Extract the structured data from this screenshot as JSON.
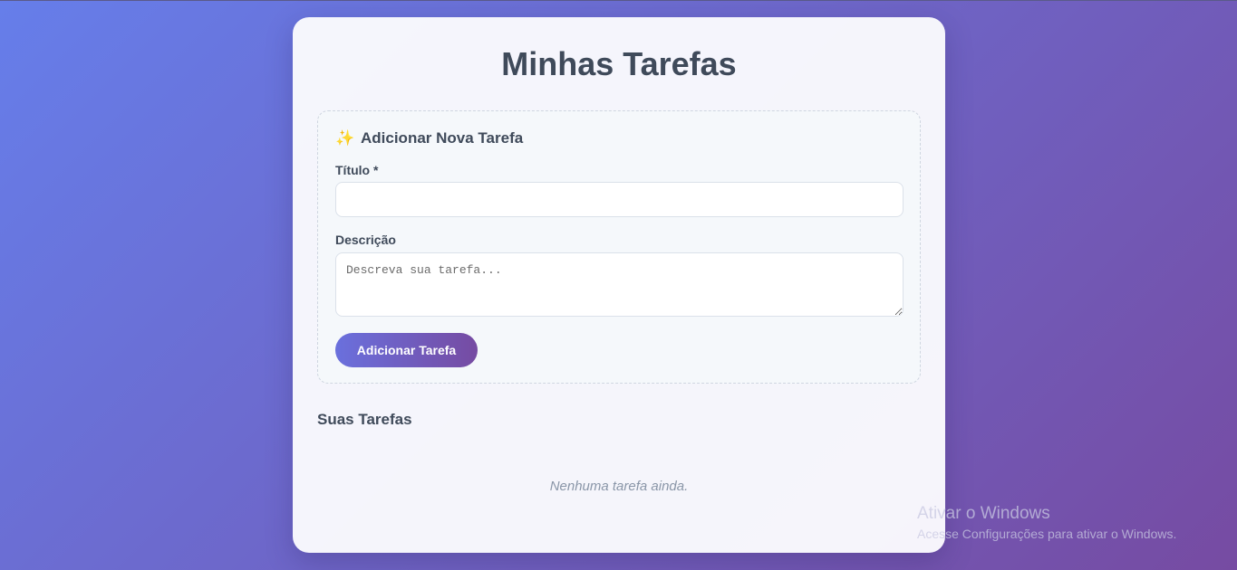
{
  "page": {
    "title": "Minhas Tarefas"
  },
  "form": {
    "heading_icon": "sparkles-icon",
    "heading_icon_glyph": "✨",
    "heading": "Adicionar Nova Tarefa",
    "title_label": "Título *",
    "title_value": "",
    "title_placeholder": "",
    "description_label": "Descrição",
    "description_value": "",
    "description_placeholder": "Descreva sua tarefa...",
    "submit_label": "Adicionar Tarefa"
  },
  "tasks": {
    "heading": "Suas Tarefas",
    "items": [],
    "empty_message": "Nenhuma tarefa ainda."
  },
  "os_watermark": {
    "title": "Ativar o Windows",
    "subtitle": "Acesse Configurações para ativar o Windows."
  },
  "colors": {
    "gradient_start": "#667eea",
    "gradient_end": "#764ba2",
    "text_dark": "#3f4a5a",
    "muted": "#8a96a8"
  }
}
